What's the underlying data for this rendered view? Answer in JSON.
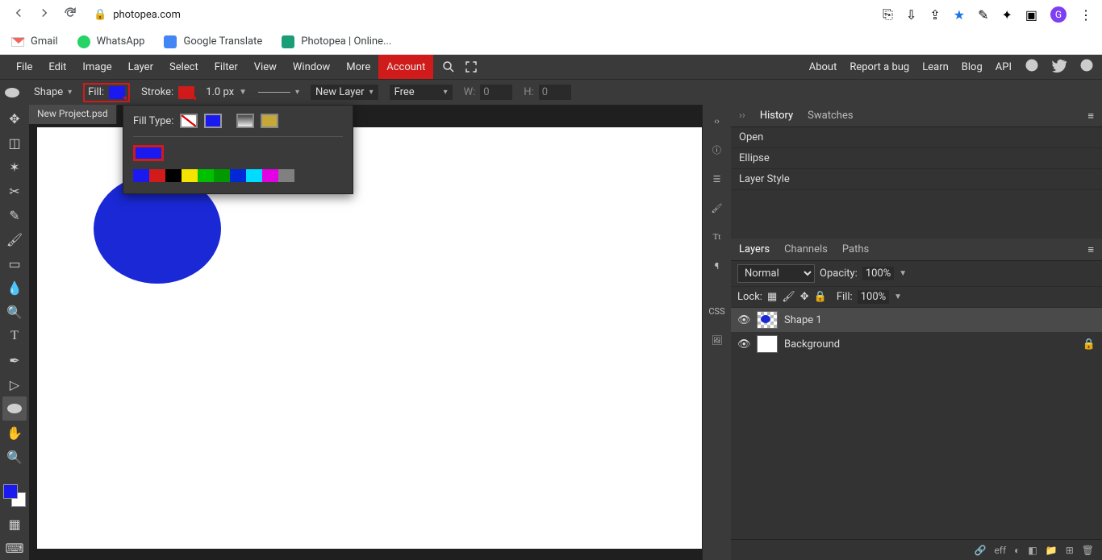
{
  "browser": {
    "url": "photopea.com",
    "avatar_letter": "G",
    "bookmarks": [
      {
        "label": "Gmail"
      },
      {
        "label": "WhatsApp"
      },
      {
        "label": "Google Translate"
      },
      {
        "label": "Photopea | Online..."
      }
    ]
  },
  "menubar": {
    "items": [
      "File",
      "Edit",
      "Image",
      "Layer",
      "Select",
      "Filter",
      "View",
      "Window",
      "More"
    ],
    "account": "Account",
    "right": [
      "About",
      "Report a bug",
      "Learn",
      "Blog",
      "API"
    ]
  },
  "options": {
    "mode": "Shape",
    "fill_label": "Fill:",
    "stroke_label": "Stroke:",
    "fill_color": "#1a1af0",
    "stroke_color": "#d11b1b",
    "stroke_width": "1.0 px",
    "layer_mode": "New Layer",
    "constrain": "Free",
    "w_label": "W:",
    "h_label": "H:",
    "w": "0",
    "h": "0"
  },
  "tabs": {
    "name": "New Project.psd"
  },
  "fill_popup": {
    "title": "Fill Type:",
    "palette": [
      "#1a1af0",
      "#d11b1b",
      "#000000",
      "#f4e400",
      "#00c000",
      "#009900",
      "#0028d6",
      "#00dcff",
      "#e400e4",
      "#808080"
    ]
  },
  "history": {
    "tabs": [
      "History",
      "Swatches"
    ],
    "rows": [
      "Open",
      "Ellipse",
      "Layer Style"
    ]
  },
  "layers": {
    "tabs": [
      "Layers",
      "Channels",
      "Paths"
    ],
    "blend": "Normal",
    "opacity_label": "Opacity:",
    "opacity": "100%",
    "lock_label": "Lock:",
    "fill_label": "Fill:",
    "fill": "100%",
    "items": [
      {
        "name": "Shape 1"
      },
      {
        "name": "Background"
      }
    ],
    "footer_text": "eff"
  },
  "right_strip": {
    "css": "CSS",
    "tt": "Tt"
  }
}
